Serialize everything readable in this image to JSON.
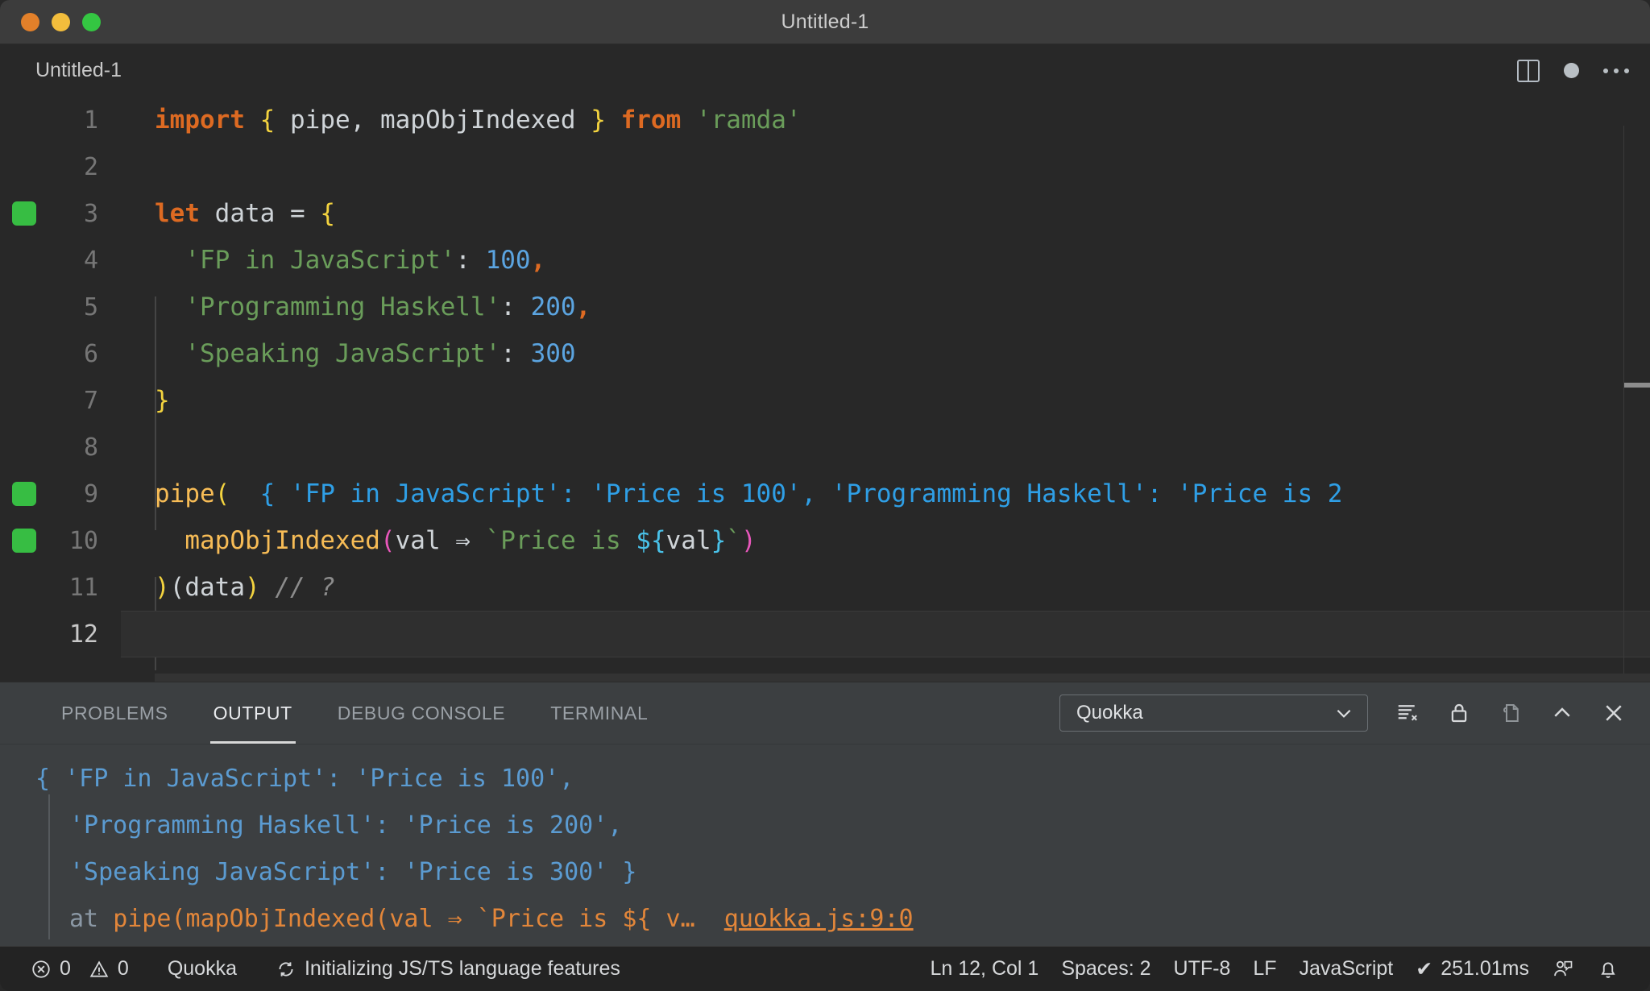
{
  "window": {
    "title": "Untitled-1",
    "traffic_lights": [
      "close",
      "minimize",
      "maximize"
    ]
  },
  "editor_header": {
    "tab_label": "Untitled-1",
    "actions": [
      "split-editor-icon",
      "unsaved-dot-icon",
      "more-actions-icon"
    ]
  },
  "editor": {
    "language": "JavaScript",
    "lines": [
      {
        "n": "1",
        "marker": false
      },
      {
        "n": "2",
        "marker": false
      },
      {
        "n": "3",
        "marker": true
      },
      {
        "n": "4",
        "marker": false
      },
      {
        "n": "5",
        "marker": false
      },
      {
        "n": "6",
        "marker": false
      },
      {
        "n": "7",
        "marker": false
      },
      {
        "n": "8",
        "marker": false
      },
      {
        "n": "9",
        "marker": true
      },
      {
        "n": "10",
        "marker": true
      },
      {
        "n": "11",
        "marker": false
      },
      {
        "n": "12",
        "marker": false,
        "current": true
      }
    ],
    "code": {
      "l1_import": "import",
      "l1_brace_open": "{",
      "l1_names": " pipe, mapObjIndexed ",
      "l1_brace_close": "}",
      "l1_from": "from",
      "l1_module": "'ramda'",
      "l3_let": "let",
      "l3_name": " data = ",
      "l3_brace": "{",
      "l4_key": "'FP in JavaScript'",
      "l4_colon": ": ",
      "l4_val": "100",
      "l4_comma": ",",
      "l5_key": "'Programming Haskell'",
      "l5_colon": ": ",
      "l5_val": "200",
      "l5_comma": ",",
      "l6_key": "'Speaking JavaScript'",
      "l6_colon": ": ",
      "l6_val": "300",
      "l7_brace": "}",
      "l9_fn": "pipe",
      "l9_paren": "(",
      "l9_hint": "  { 'FP in JavaScript': 'Price is 100', 'Programming Haskell': 'Price is 2",
      "l10_fn": "mapObjIndexed",
      "l10_paren_open": "(",
      "l10_param": "val ",
      "l10_arrow": "⇒",
      "l10_tpl_open": " `Price is ",
      "l10_interp_open": "${",
      "l10_interp_val": "val",
      "l10_interp_close": "}",
      "l10_tpl_close": "`",
      "l10_paren_close": ")",
      "l11_paren_open": ")",
      "l11_paren2": "(",
      "l11_arg": "data",
      "l11_paren_close": ")",
      "l11_comment": "// ?"
    }
  },
  "panel": {
    "tabs": [
      {
        "label": "PROBLEMS",
        "active": false
      },
      {
        "label": "OUTPUT",
        "active": true
      },
      {
        "label": "DEBUG CONSOLE",
        "active": false
      },
      {
        "label": "TERMINAL",
        "active": false
      }
    ],
    "channel_select": {
      "value": "Quokka",
      "options": [
        "Quokka"
      ]
    },
    "actions": [
      "clear-output-icon",
      "lock-scroll-icon",
      "open-in-editor-icon",
      "maximize-panel-icon",
      "close-panel-icon"
    ],
    "output": {
      "line1": "{ 'FP in JavaScript': 'Price is 100',",
      "line2": "'Programming Haskell': 'Price is 200',",
      "line3": "'Speaking JavaScript': 'Price is 300' }",
      "line4_at": "at ",
      "line4_frame": "pipe(mapObjIndexed(val ⇒ `Price is ${ v…",
      "line4_link": "quokka.js:9:0"
    }
  },
  "statusbar": {
    "errors": "0",
    "warnings": "0",
    "quokka": "Quokka",
    "task": "Initializing JS/TS language features",
    "cursor": "Ln 12, Col 1",
    "indent": "Spaces: 2",
    "encoding": "UTF-8",
    "eol": "LF",
    "language": "JavaScript",
    "timing": "251.01ms",
    "timing_check": "✔"
  },
  "colors": {
    "keyword": "#dd6a22",
    "string": "#6a9d5a",
    "number": "#5ba4e0",
    "function": "#f7bc56",
    "punctuation": "#f3d33f",
    "comment": "#8c8c8c",
    "inline_hint": "#2f9fe6",
    "output_text": "#5b9bd1",
    "output_error": "#e2863a",
    "gutter_marker": "#37bd43"
  }
}
